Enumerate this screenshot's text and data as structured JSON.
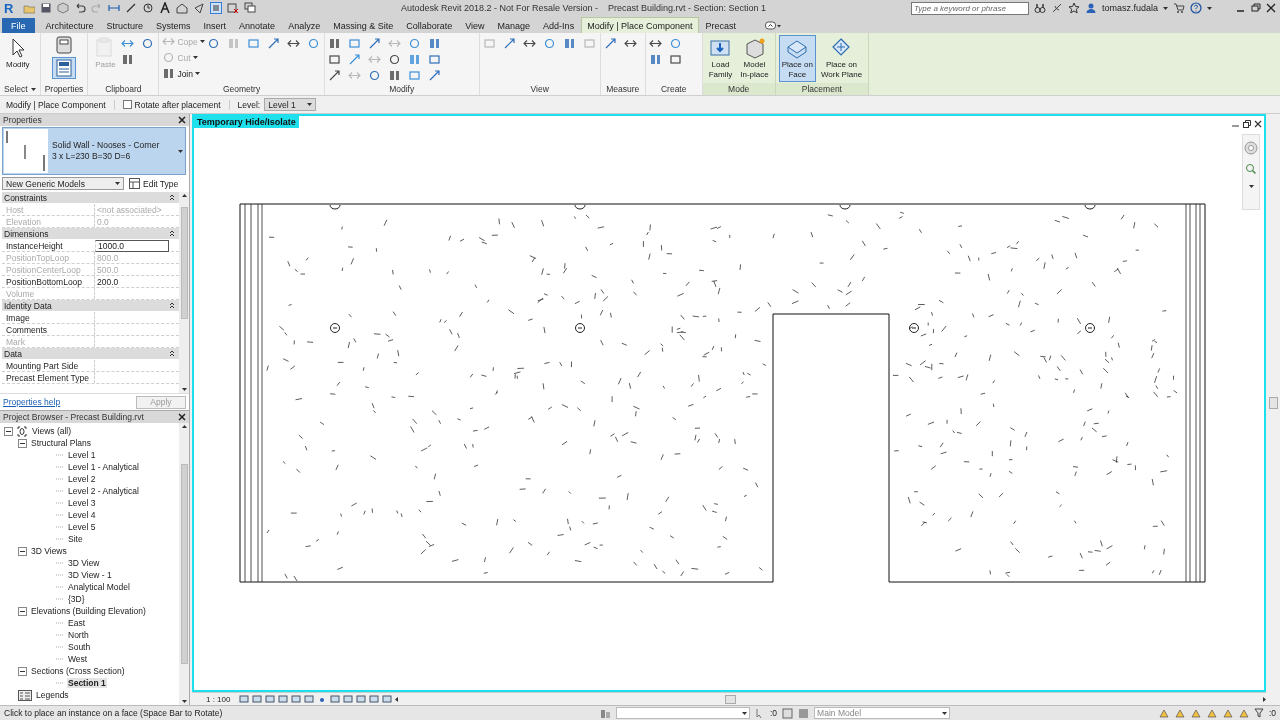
{
  "title_bar": {
    "logo": "R",
    "title": "Autodesk Revit 2018.2 - Not For Resale Version -    Precast Building.rvt - Section: Section 1",
    "search": {
      "placeholder": "Type a keyword or phrase"
    },
    "user": "tomasz.fudala"
  },
  "ribbon_tabs": [
    {
      "label": "File",
      "kind": "file",
      "selected": false
    },
    {
      "label": "Architecture",
      "kind": "tab",
      "selected": false
    },
    {
      "label": "Structure",
      "kind": "tab",
      "selected": false
    },
    {
      "label": "Systems",
      "kind": "tab",
      "selected": false
    },
    {
      "label": "Insert",
      "kind": "tab",
      "selected": false
    },
    {
      "label": "Annotate",
      "kind": "tab",
      "selected": false
    },
    {
      "label": "Analyze",
      "kind": "tab",
      "selected": false
    },
    {
      "label": "Massing & Site",
      "kind": "tab",
      "selected": false
    },
    {
      "label": "Collaborate",
      "kind": "tab",
      "selected": false
    },
    {
      "label": "View",
      "kind": "tab",
      "selected": false
    },
    {
      "label": "Manage",
      "kind": "tab",
      "selected": false
    },
    {
      "label": "Add-Ins",
      "kind": "tab",
      "selected": false
    },
    {
      "label": "Modify | Place Component",
      "kind": "tab",
      "selected": true
    },
    {
      "label": "Precast",
      "kind": "tab",
      "selected": false
    }
  ],
  "ribbon_panels": [
    {
      "label": "Select",
      "contextual": false,
      "buttons": [
        {
          "kind": "large",
          "label": "Modify",
          "selected": false,
          "disabled": false
        }
      ]
    },
    {
      "label": "Properties",
      "contextual": false,
      "buttons": [
        {
          "kind": "icon",
          "selected": true
        }
      ]
    },
    {
      "label": "Clipboard",
      "contextual": false,
      "buttons": [
        {
          "kind": "large",
          "label": "Paste",
          "selected": false,
          "disabled": true
        }
      ]
    },
    {
      "label": "Geometry",
      "contextual": false,
      "buttons": [
        {
          "kind": "small",
          "label": "Cope",
          "disabled": true
        },
        {
          "kind": "small",
          "label": "Cut",
          "disabled": true
        },
        {
          "kind": "small",
          "label": "Join",
          "disabled": false
        }
      ]
    },
    {
      "label": "Modify",
      "contextual": false
    },
    {
      "label": "View",
      "contextual": false
    },
    {
      "label": "Measure",
      "contextual": false
    },
    {
      "label": "Create",
      "contextual": false
    },
    {
      "label": "Mode",
      "contextual": true,
      "buttons": [
        {
          "kind": "large",
          "label": "Load\nFamily",
          "selected": false,
          "disabled": false
        },
        {
          "kind": "large",
          "label": "Model\nIn-place",
          "selected": false,
          "disabled": false
        }
      ]
    },
    {
      "label": "Placement",
      "contextual": true,
      "buttons": [
        {
          "kind": "large",
          "label": "Place on\nFace",
          "selected": true,
          "disabled": false
        },
        {
          "kind": "large",
          "label": "Place on\nWork Plane",
          "selected": false,
          "disabled": false
        }
      ]
    }
  ],
  "options_bar": {
    "context": "Modify | Place Component",
    "rotate_after_placement": {
      "label": "Rotate after placement",
      "checked": false
    },
    "level_label": "Level:",
    "level": "Level 1"
  },
  "properties": {
    "title": "Properties",
    "type_name": "Solid Wall - Nooses - Corner",
    "type_detail": "3 x L=230 B=30 D=6",
    "filter": "New Generic Models",
    "edit_type": "Edit Type",
    "groups": [
      {
        "name": "Constraints",
        "rows": [
          {
            "name": "Host",
            "value": "<not associated>",
            "disabled": true,
            "editing": false
          },
          {
            "name": "Elevation",
            "value": "0.0",
            "disabled": true,
            "editing": false
          }
        ]
      },
      {
        "name": "Dimensions",
        "rows": [
          {
            "name": "InstanceHeight",
            "value": "1000.0",
            "disabled": false,
            "editing": true
          },
          {
            "name": "PositionTopLoop",
            "value": "800.0",
            "disabled": true,
            "editing": false
          },
          {
            "name": "PositionCenterLoop",
            "value": "500.0",
            "disabled": true,
            "editing": false
          },
          {
            "name": "PositionBottomLoop",
            "value": "200.0",
            "disabled": false,
            "editing": false
          },
          {
            "name": "Volume",
            "disabled": true,
            "editing": false
          }
        ]
      },
      {
        "name": "Identity Data",
        "rows": [
          {
            "name": "Image",
            "disabled": false,
            "editing": false
          },
          {
            "name": "Comments",
            "disabled": false,
            "editing": false
          },
          {
            "name": "Mark",
            "disabled": true,
            "editing": false
          }
        ]
      },
      {
        "name": "Data",
        "rows": [
          {
            "name": "Mounting Part Side",
            "disabled": false,
            "editing": false
          },
          {
            "name": "Precast Element Type",
            "disabled": false,
            "editing": false
          }
        ]
      }
    ],
    "help": "Properties help",
    "apply": {
      "label": "Apply",
      "disabled": true
    }
  },
  "project_browser": {
    "title": "Project Browser - Precast Building.rvt",
    "tree": [
      {
        "label": "Views (all)",
        "kind": "views",
        "expanded": true,
        "selected": false,
        "children": [
          {
            "label": "Structural Plans",
            "expanded": true,
            "selected": false,
            "children": [
              {
                "label": "Level 1",
                "selected": false
              },
              {
                "label": "Level 1 - Analytical",
                "selected": false
              },
              {
                "label": "Level 2",
                "selected": false
              },
              {
                "label": "Level 2 - Analytical",
                "selected": false
              },
              {
                "label": "Level 3",
                "selected": false
              },
              {
                "label": "Level 4",
                "selected": false
              },
              {
                "label": "Level 5",
                "selected": false
              },
              {
                "label": "Site",
                "selected": false
              }
            ]
          },
          {
            "label": "3D Views",
            "expanded": true,
            "selected": false,
            "children": [
              {
                "label": "3D View",
                "selected": false
              },
              {
                "label": "3D View - 1",
                "selected": false
              },
              {
                "label": "Analytical Model",
                "selected": false
              },
              {
                "label": "{3D}",
                "selected": false
              }
            ]
          },
          {
            "label": "Elevations (Building Elevation)",
            "expanded": true,
            "selected": false,
            "children": [
              {
                "label": "East",
                "selected": false
              },
              {
                "label": "North",
                "selected": false
              },
              {
                "label": "South",
                "selected": false
              },
              {
                "label": "West",
                "selected": false
              }
            ]
          },
          {
            "label": "Sections (Cross Section)",
            "expanded": true,
            "selected": false,
            "children": [
              {
                "label": "Section 1",
                "selected": true
              }
            ]
          }
        ]
      },
      {
        "label": "Legends",
        "kind": "legends",
        "selected": false
      }
    ]
  },
  "view": {
    "badge": "Temporary Hide/Isolate",
    "scale": "1 : 100"
  },
  "status_bar": {
    "message": "Click to place an instance on a face (Space Bar to Rotate)",
    "selection_count": ":0",
    "workset": "Main Model",
    "filter_count": ":0"
  }
}
